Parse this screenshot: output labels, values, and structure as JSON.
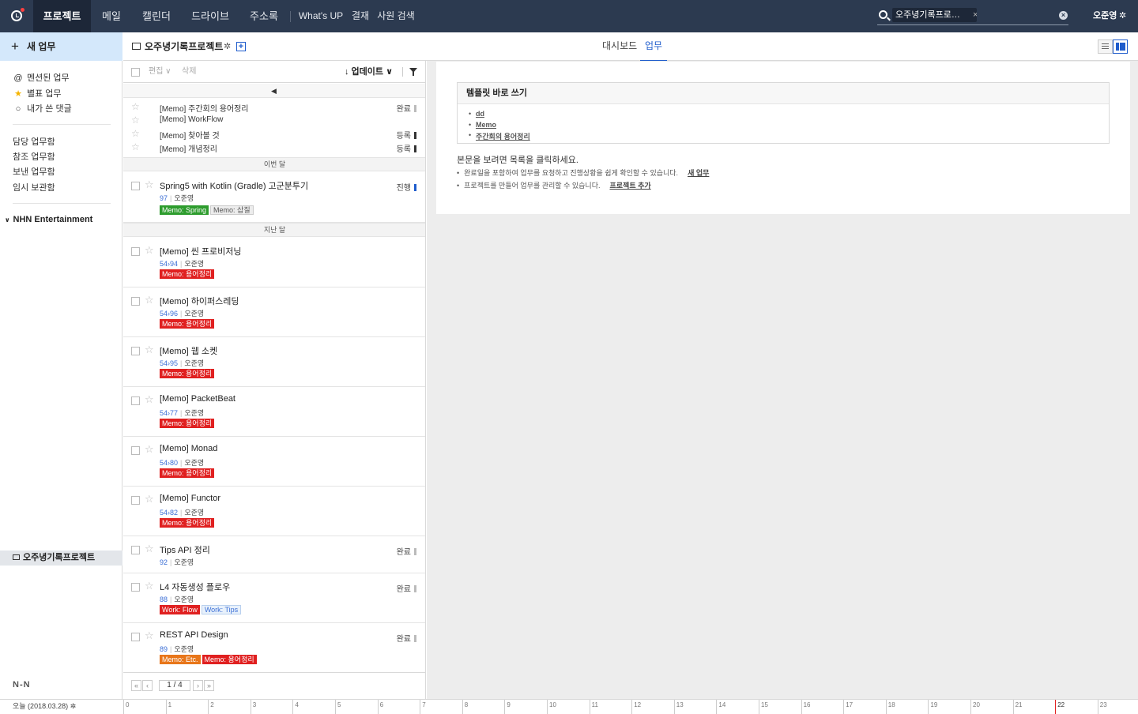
{
  "nav": {
    "tabs": [
      {
        "label": "프로젝트"
      },
      {
        "label": "메일"
      },
      {
        "label": "캘린더"
      },
      {
        "label": "드라이브"
      },
      {
        "label": "주소록"
      },
      {
        "label": "What's UP"
      },
      {
        "label": "결재"
      },
      {
        "label": "사원 검색"
      }
    ],
    "search_chip": "오주녕기록프로…",
    "chip_close": "×",
    "clear": "×",
    "user_name": "오준영",
    "user_gear": "✲"
  },
  "sidebar": {
    "new_task": "새 업무",
    "new_task_icon": "+",
    "quick": [
      {
        "icon": "@",
        "label": "멘션된 업무"
      },
      {
        "icon": "★",
        "label": "별표 업무"
      },
      {
        "icon": "○",
        "label": "내가 쓴 댓글"
      }
    ],
    "boxes": [
      {
        "label": "담당 업무함"
      },
      {
        "label": "참조 업무함"
      },
      {
        "label": "보낸 업무함"
      },
      {
        "label": "임시 보관함"
      }
    ],
    "org": "NHN Entertainment",
    "org_chevron": "∨",
    "project": "오주녕기록프로젝트",
    "logo_text": "N-N"
  },
  "project": {
    "title": "오주녕기록프로젝트",
    "gear": "✲",
    "add": "+",
    "tabs": [
      {
        "label": "대시보드"
      },
      {
        "label": "업무"
      }
    ]
  },
  "list": {
    "toolbar": {
      "edit": "편집 ∨",
      "delete": "삭제",
      "sort": "↓ 업데이트 ∨"
    },
    "notice_icon": "◀",
    "memos": [
      {
        "title": "[Memo] 주간회의 용어정리",
        "status": "완료"
      },
      {
        "title": "[Memo] WorkFlow",
        "status": ""
      },
      {
        "title": "[Memo] 찾아볼 것",
        "status": "등록"
      },
      {
        "title": "[Memo] 개념정리",
        "status": "등록"
      }
    ],
    "sections": {
      "this_month": "이번 달",
      "last_month": "지난 달"
    },
    "tasks": [
      {
        "title": "Spring5 with Kotlin (Gradle) 고군분투기",
        "num": "97",
        "author": "오준영",
        "status": "진행",
        "tags": [
          {
            "text": "Memo: Spring"
          },
          {
            "text": "Memo: 삽질"
          }
        ]
      },
      {
        "title": "[Memo] 씬 프로비저닝",
        "num": "54›94",
        "author": "오준영",
        "status": "",
        "tags": [
          {
            "text": "Memo: 용어정리"
          }
        ]
      },
      {
        "title": "[Memo] 하이퍼스레딩",
        "num": "54›96",
        "author": "오준영",
        "status": "",
        "tags": [
          {
            "text": "Memo: 용어정리"
          }
        ]
      },
      {
        "title": "[Memo] 웹 소켓",
        "num": "54›95",
        "author": "오준영",
        "status": "",
        "tags": [
          {
            "text": "Memo: 용어정리"
          }
        ]
      },
      {
        "title": "[Memo] PacketBeat",
        "num": "54›77",
        "author": "오준영",
        "status": "",
        "tags": [
          {
            "text": "Memo: 용어정리"
          }
        ]
      },
      {
        "title": "[Memo] Monad",
        "num": "54›80",
        "author": "오준영",
        "status": "",
        "tags": [
          {
            "text": "Memo: 용어정리"
          }
        ]
      },
      {
        "title": "[Memo] Functor",
        "num": "54›82",
        "author": "오준영",
        "status": "",
        "tags": [
          {
            "text": "Memo: 용어정리"
          }
        ]
      },
      {
        "title": "Tips API 정리",
        "num": "92",
        "author": "오준영",
        "status": "완료",
        "tags": []
      },
      {
        "title": "L4 자동생성 플로우",
        "num": "88",
        "author": "오준영",
        "status": "완료",
        "tags": [
          {
            "text": "Work: Flow"
          },
          {
            "text": "Work: Tips"
          }
        ]
      },
      {
        "title": "REST API Design",
        "num": "89",
        "author": "오준영",
        "status": "완료",
        "tags": [
          {
            "text": "Memo: Etc."
          },
          {
            "text": "Memo: 용어정리"
          }
        ]
      }
    ],
    "pager": {
      "first": "«",
      "prev": "‹",
      "page": "1 / 4",
      "next": "›",
      "last": "»"
    }
  },
  "detail": {
    "template_title": "템플릿 바로 쓰기",
    "templates": [
      {
        "label": "dd"
      },
      {
        "label": "Memo"
      },
      {
        "label": "주간회의 용어정리"
      }
    ],
    "hint_title": "본문을 보려면 목록을 클릭하세요.",
    "hints": [
      {
        "text": "완료일을 포함하여 업무를 요청하고 진행상황을 쉽게 확인할 수 있습니다.",
        "link": "새 업무"
      },
      {
        "text": "프로젝트를 만들어 업무를 관리할 수 있습니다.",
        "link": "프로젝트 추가"
      }
    ],
    "bullet": "•"
  },
  "timeline": {
    "today": "오늘 (2018.03.28) ✲",
    "ticks": [
      "0",
      "1",
      "2",
      "3",
      "4",
      "5",
      "6",
      "7",
      "8",
      "9",
      "10",
      "11",
      "12",
      "13",
      "14",
      "15",
      "16",
      "17",
      "18",
      "19",
      "20",
      "21",
      "22",
      "23"
    ],
    "current_hour": "22"
  },
  "colors": {
    "nav_bg": "#2c3a50",
    "accent": "#1f5ccc",
    "tag_red": "#e02020",
    "tag_green": "#2d9c2d",
    "tag_orange": "#e8761a"
  }
}
